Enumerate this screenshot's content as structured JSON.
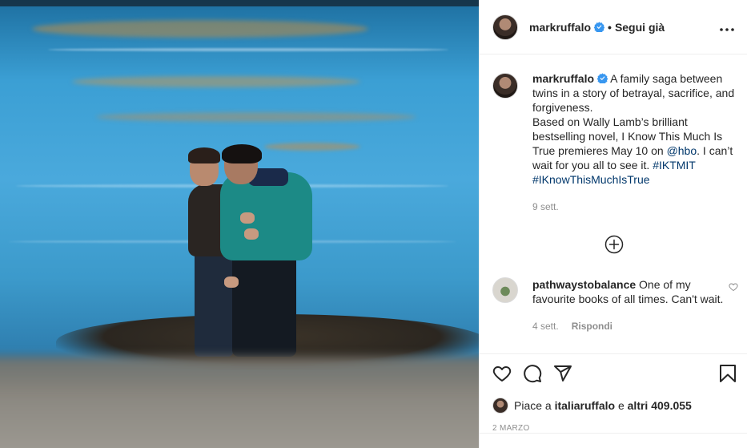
{
  "post": {
    "username": "markruffalo",
    "verified": true,
    "separator": "•",
    "follow_status": "Segui già",
    "more_icon": "more-horizontal-icon"
  },
  "caption": {
    "username": "markruffalo",
    "text_1": "A family saga between twins in a story of betrayal, sacrifice, and forgiveness.",
    "text_2": "Based on Wally Lamb’s brilliant bestselling novel, I Know This Much Is True premieres May 10 on ",
    "mention": "@hbo",
    "text_3": ". I can’t wait for you all to see it. ",
    "hashtag_1": "#IKTMIT",
    "hashtag_2": "#IKnowThisMuchIsTrue",
    "time": "9 sett."
  },
  "load_more_icon": "plus-circle-icon",
  "comment": {
    "username": "pathwaystobalance",
    "text": "One of my favourite books of all times. Can't wait.",
    "time": "4 sett.",
    "reply_label": "Rispondi"
  },
  "actions": {
    "like_icon": "heart-icon",
    "comment_icon": "comment-icon",
    "share_icon": "send-icon",
    "save_icon": "bookmark-icon"
  },
  "likes": {
    "prefix": "Piace a ",
    "user": "italiaruffalo",
    "middle": " e ",
    "others": "altri 409.055"
  },
  "date": "2 MARZO",
  "colors": {
    "link": "#00376b",
    "verified": "#3897f0",
    "muted": "#8e8e8e"
  }
}
